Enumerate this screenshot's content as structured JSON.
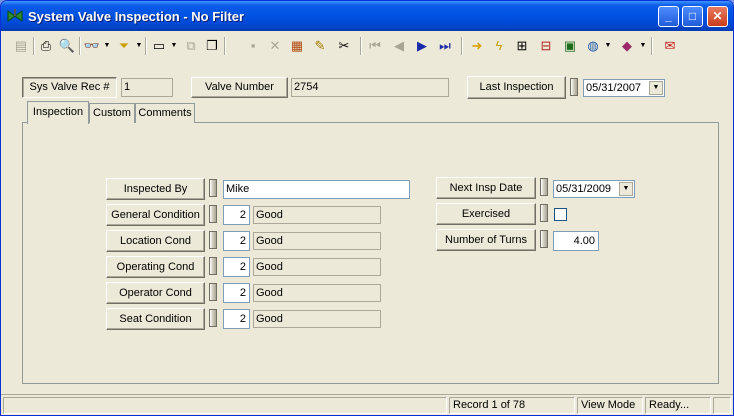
{
  "window": {
    "title": "System Valve Inspection - No Filter"
  },
  "title_buttons": {
    "minimize": "_",
    "maximize": "□",
    "close": "✕"
  },
  "toolbar": {
    "icons": [
      "new-record-icon",
      "print-icon",
      "print-preview-icon",
      "binoculars-icon",
      "filter-icon",
      "form-icon",
      "copy-form-icon",
      "copy-icon",
      "save-icon",
      "delete-icon",
      "books-icon",
      "pencil-icon",
      "scissors-icon",
      "first-record-icon",
      "previous-record-icon",
      "next-record-icon",
      "last-record-icon",
      "goto-arrow-icon",
      "lightning-icon",
      "tree-icon",
      "hierarchy-icon",
      "map-icon",
      "globe-icon",
      "book-icon",
      "mail-icon"
    ]
  },
  "header": {
    "sys_valve_rec_label": "Sys Valve Rec #",
    "sys_valve_rec_value": "1",
    "valve_number_label": "Valve Number",
    "valve_number_value": "2754",
    "last_inspection_label": "Last Inspection",
    "last_inspection_value": "05/31/2007"
  },
  "tabs": [
    "Inspection",
    "Custom",
    "Comments"
  ],
  "inspection": {
    "inspected_by_label": "Inspected By",
    "inspected_by_value": "Mike",
    "rows": [
      {
        "label": "General Condition",
        "code": "2",
        "desc": "Good"
      },
      {
        "label": "Location Cond",
        "code": "2",
        "desc": "Good"
      },
      {
        "label": "Operating Cond",
        "code": "2",
        "desc": "Good"
      },
      {
        "label": "Operator Cond",
        "code": "2",
        "desc": "Good"
      },
      {
        "label": "Seat Condition",
        "code": "2",
        "desc": "Good"
      }
    ],
    "next_insp_date_label": "Next Insp Date",
    "next_insp_date_value": "05/31/2009",
    "exercised_label": "Exercised",
    "exercised_checked": false,
    "number_of_turns_label": "Number of Turns",
    "number_of_turns_value": "4.00"
  },
  "status": {
    "record": "Record 1 of 78",
    "mode": "View Mode",
    "state": "Ready..."
  },
  "colors": {
    "titlebar": "#0054e3",
    "face": "#ece9d8",
    "field_border": "#7f9db9"
  }
}
